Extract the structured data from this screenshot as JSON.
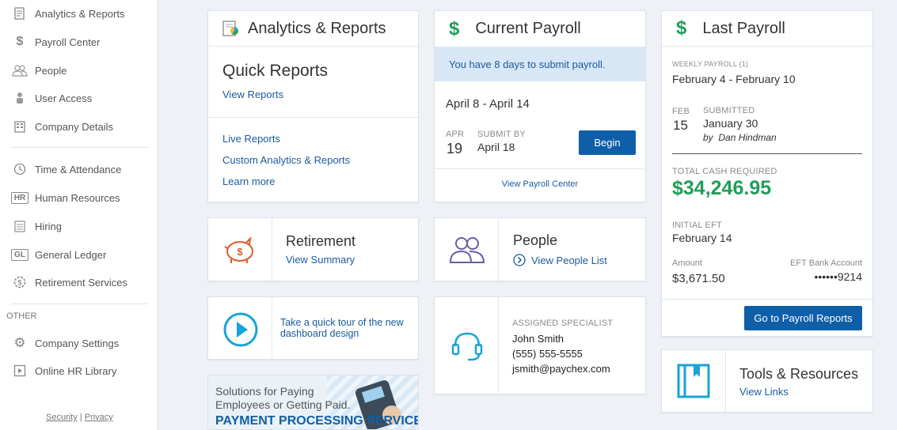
{
  "sidebar": {
    "items": [
      {
        "label": "Analytics & Reports",
        "icon": "report-icon"
      },
      {
        "label": "Payroll Center",
        "icon": "dollar-icon"
      },
      {
        "label": "People",
        "icon": "people-icon"
      },
      {
        "label": "User Access",
        "icon": "user-access-icon"
      },
      {
        "label": "Company Details",
        "icon": "building-icon"
      },
      {
        "label": "Time & Attendance",
        "icon": "clock-icon"
      },
      {
        "label": "Human Resources",
        "icon": "hr-icon"
      },
      {
        "label": "Hiring",
        "icon": "clipboard-icon"
      },
      {
        "label": "General Ledger",
        "icon": "gl-icon"
      },
      {
        "label": "Retirement Services",
        "icon": "gear-dollar-icon"
      }
    ],
    "other_heading": "OTHER",
    "other_items": [
      {
        "label": "Company Settings",
        "icon": "gear-icon"
      },
      {
        "label": "Online HR Library",
        "icon": "play-icon"
      }
    ],
    "footer": {
      "security": "Security",
      "sep": "|",
      "privacy": "Privacy"
    }
  },
  "analytics": {
    "title": "Analytics & Reports",
    "quick_reports_title": "Quick Reports",
    "view_reports": "View Reports",
    "links": [
      "Live Reports",
      "Custom Analytics & Reports",
      "Learn more"
    ]
  },
  "current_payroll": {
    "title": "Current Payroll",
    "notice": "You have 8 days to submit payroll.",
    "period": "April 8 - April 14",
    "month": "APR",
    "day": "19",
    "submit_by_label": "SUBMIT BY",
    "submit_by_date": "April 18",
    "begin": "Begin",
    "view_center": "View Payroll Center"
  },
  "last_payroll": {
    "title": "Last Payroll",
    "weekly_label": "WEEKLY PAYROLL (1)",
    "period": "February 4 - February 10",
    "month": "FEB",
    "day": "15",
    "submitted_label": "SUBMITTED",
    "submitted_date": "January 30",
    "by": "by",
    "by_name": "Dan Hindman",
    "total_cash_label": "TOTAL CASH REQUIRED",
    "total_cash": "$34,246.95",
    "initial_eft_label": "INITIAL EFT",
    "initial_eft_date": "February 14",
    "amount_label": "Amount",
    "amount": "$3,671.50",
    "eft_account_label": "EFT Bank Account",
    "eft_account": "••••••9214",
    "go_reports": "Go to Payroll Reports"
  },
  "retirement": {
    "title": "Retirement",
    "link": "View Summary"
  },
  "people": {
    "title": "People",
    "link": "View People List"
  },
  "tour": {
    "text": "Take a quick tour of the new dashboard design"
  },
  "specialist": {
    "label": "ASSIGNED SPECIALIST",
    "name": "John Smith",
    "phone": "(555) 555-5555",
    "email": "jsmith@paychex.com"
  },
  "tools": {
    "title": "Tools & Resources",
    "link": "View Links"
  },
  "ad": {
    "line1": "Solutions for Paying",
    "line2": "Employees or Getting Paid.",
    "line3": "PAYMENT PROCESSING SERVICES"
  },
  "colors": {
    "accent": "#0f5fa8",
    "green": "#1e9e5a",
    "notice_bg": "#d7e7f5",
    "orange": "#e05a2b",
    "purple": "#6b5ea8",
    "teal": "#1aa3d6"
  }
}
